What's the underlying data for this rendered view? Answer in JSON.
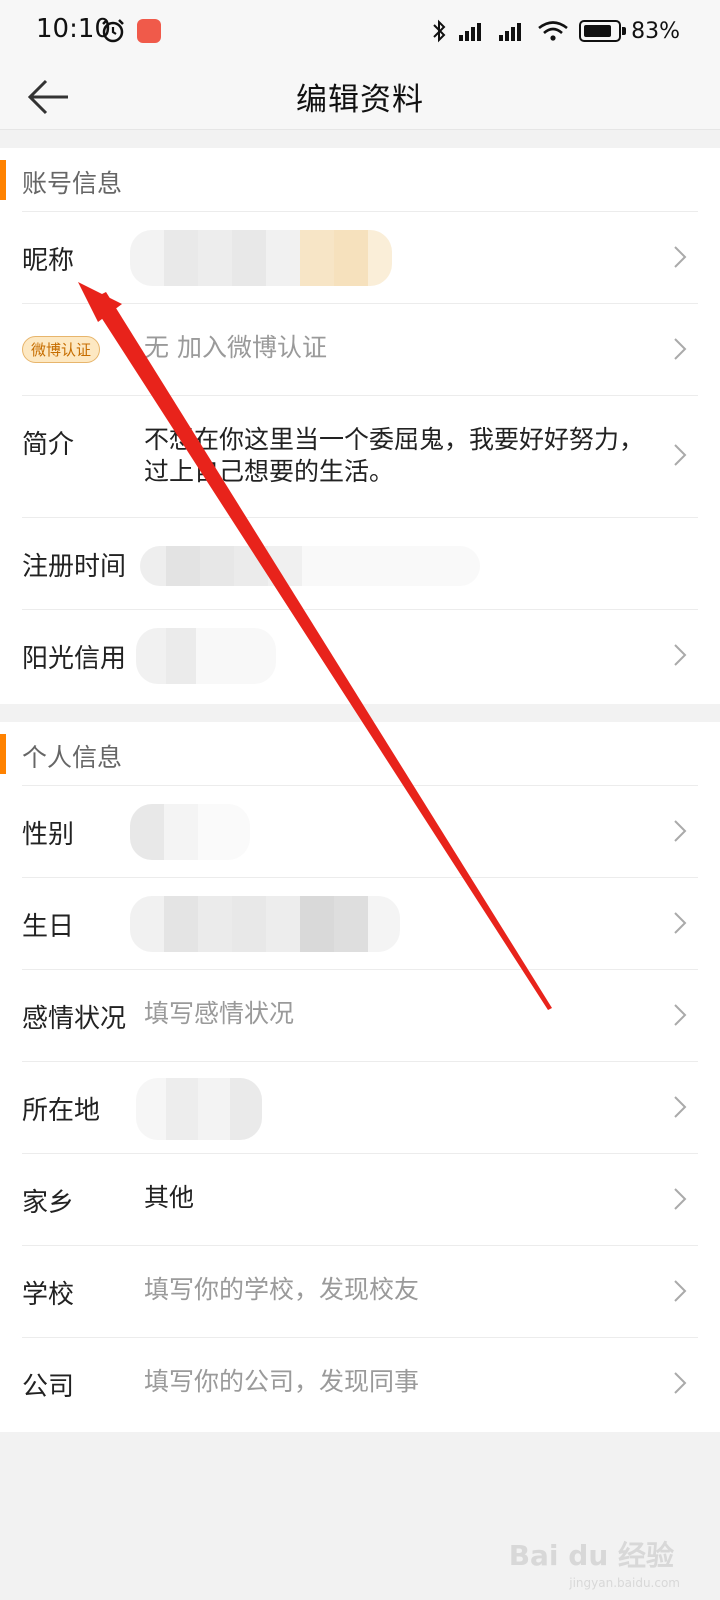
{
  "status_bar": {
    "time": "10:10",
    "battery": "83%",
    "battery_level": 0.83
  },
  "nav": {
    "title": "编辑资料"
  },
  "account_section": {
    "title": "账号信息",
    "nickname_label": "昵称",
    "verify_badge": "微博认证",
    "verify_value": "无 加入微博认证",
    "bio_label": "简介",
    "bio_value": "不想在你这里当一个委屈鬼，我要好好努力，过上自己想要的生活。",
    "register_label": "注册时间",
    "credit_label": "阳光信用"
  },
  "personal_section": {
    "title": "个人信息",
    "gender_label": "性别",
    "birthday_label": "生日",
    "relationship_label": "感情状况",
    "relationship_placeholder": "填写感情状况",
    "location_label": "所在地",
    "hometown_label": "家乡",
    "hometown_value": "其他",
    "school_label": "学校",
    "school_placeholder": "填写你的学校，发现校友",
    "company_label": "公司",
    "company_placeholder": "填写你的公司，发现同事"
  },
  "watermark": {
    "brand": "Bai du 经验",
    "url": "jingyan.baidu.com"
  },
  "colors": {
    "accent": "#ff8200",
    "annotation": "#e8231b"
  }
}
